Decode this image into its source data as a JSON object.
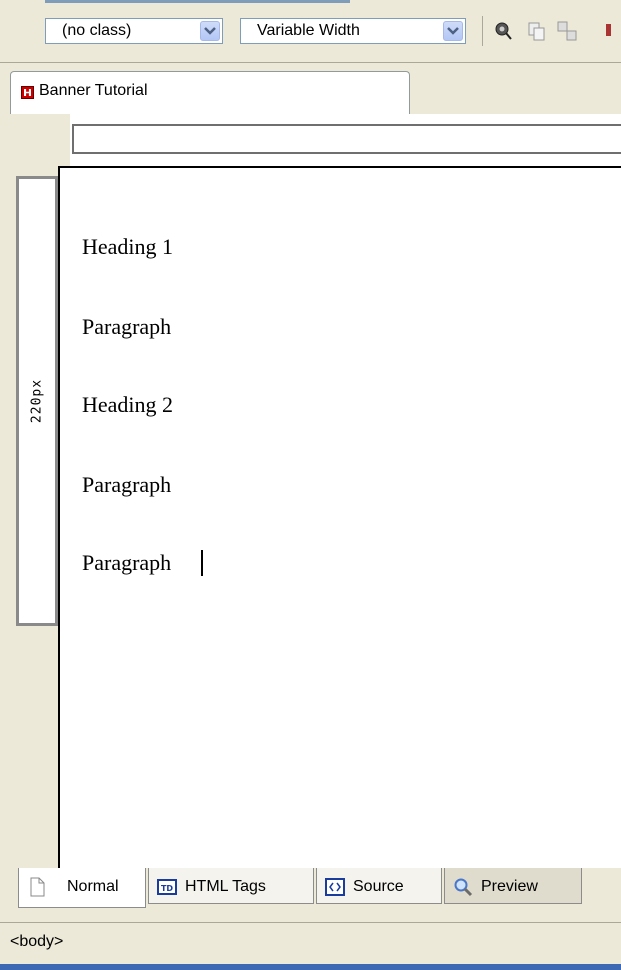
{
  "toolbar": {
    "class_select": "(no class)",
    "width_select": "Variable Width"
  },
  "document_tab": {
    "title": "Banner Tutorial"
  },
  "ruler": {
    "vertical_label": "220px"
  },
  "editor": {
    "lines": [
      "Heading 1",
      "Paragraph",
      "Heading 2",
      "Paragraph",
      "Paragraph"
    ]
  },
  "view_tabs": [
    {
      "label": "Normal",
      "icon": "page-icon"
    },
    {
      "label": "HTML Tags",
      "icon": "td-icon"
    },
    {
      "label": "Source",
      "icon": "source-icon"
    },
    {
      "label": "Preview",
      "icon": "magnifier-icon"
    }
  ],
  "status_bar": {
    "tag_path": "<body>"
  }
}
